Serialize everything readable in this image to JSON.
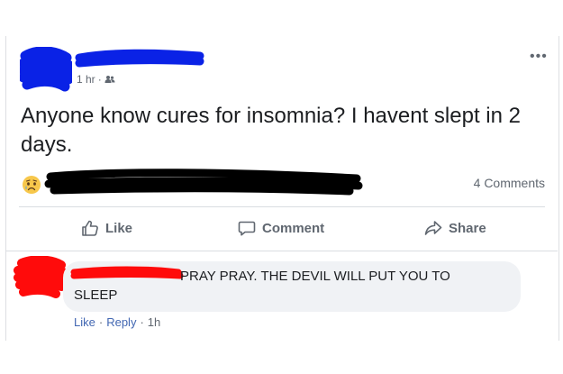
{
  "post": {
    "time": "1 hr",
    "meta_separator": "·",
    "audience_icon": "friends-icon",
    "more_icon": "more-options-icon",
    "more_label": "•••",
    "text": "Anyone know cures for insomnia? I havent slept in 2 days.",
    "reaction_icon": "sad-reaction-icon",
    "comments_count": "4 Comments"
  },
  "actions": {
    "like": "Like",
    "comment": "Comment",
    "share": "Share"
  },
  "comment": {
    "text_line1": "PRAY PRAY. THE DEVIL WILL PUT YOU TO",
    "text_line2": "SLEEP",
    "like": "Like",
    "reply": "Reply",
    "time": "1h",
    "separator": "·"
  },
  "colors": {
    "redaction_blue": "#0a22e6",
    "redaction_black": "#000000",
    "redaction_red": "#ff0b0b",
    "link_blue": "#4267b2",
    "muted_text": "#606770",
    "bubble_bg": "#f0f2f5"
  }
}
